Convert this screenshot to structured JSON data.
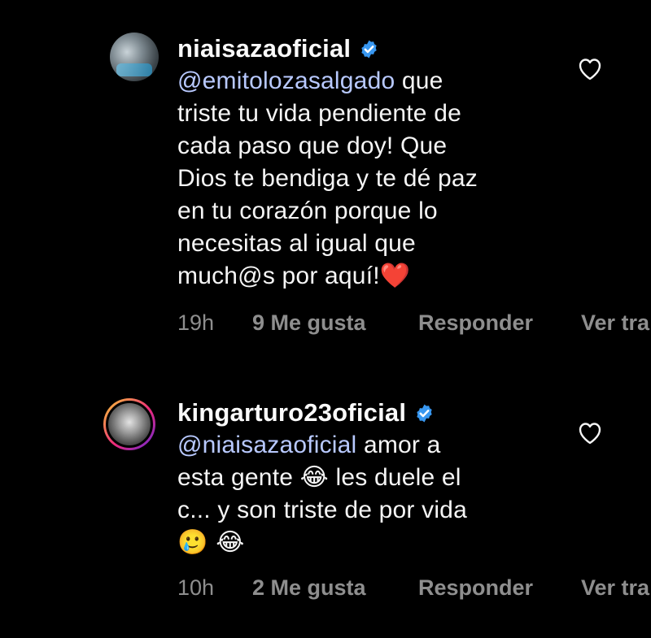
{
  "comments": [
    {
      "username": "niaisazaoficial",
      "mention": "@emitolozasalgado",
      "text_lines": [
        " que",
        "triste tu vida pendiente de",
        "cada paso que doy! Que",
        "Dios te bendiga y te dé paz",
        "en tu corazón porque lo",
        "necesitas al igual que",
        "much@s por aquí!"
      ],
      "emoji_end": "❤️",
      "time": "19h",
      "likes": "9 Me gusta",
      "reply": "Responder",
      "translate": "Ver tra"
    },
    {
      "username": "kingarturo23oficial",
      "mention": "@niaisazaoficial",
      "line1_rest": " amor a",
      "line2_a": "esta gente ",
      "emoji_laugh": "😂",
      "line2_b": " les duele el",
      "line3": "c... y son triste de por vida",
      "line4_emojis": "🥲 😂",
      "time": "10h",
      "likes": "2 Me gusta",
      "reply": "Responder",
      "translate": "Ver tra"
    }
  ],
  "colors": {
    "background": "#000000",
    "text": "#f5f5f5",
    "mention": "#b8c9ff",
    "meta": "#8e8e8e",
    "verified": "#3897f0"
  },
  "icons": {
    "verified": "verified-badge-icon",
    "like": "heart-outline-icon"
  }
}
